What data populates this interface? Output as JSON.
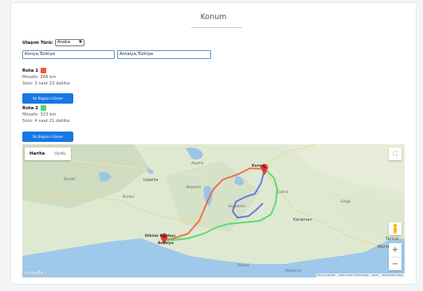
{
  "page": {
    "title": "Konum"
  },
  "form": {
    "transport_label": "Ulaşım Türü:",
    "transport_selected": "Araba",
    "origin_value": "Konya,Türkiye",
    "destination_value": "Antalya,Türkiye"
  },
  "routes": [
    {
      "title": "Rota 1",
      "color": "#f05a3a",
      "distance": "Mesafe: 266 km",
      "duration": "Süre: 3 saat 23 dakika",
      "button": "Yol Bilgisini Göster"
    },
    {
      "title": "Rota 2",
      "color": "#4cd964",
      "distance": "Mesafe: 323 km",
      "duration": "Süre: 4 saat 21 dakika",
      "button": "Yol Bilgisini Göster"
    }
  ],
  "map": {
    "type_active": "Harita",
    "type_inactive": "Uydu",
    "fullscreen_icon": "⛶",
    "zoom_in": "+",
    "zoom_out": "−",
    "google_logo": "Google",
    "attribution": {
      "shortcuts": "Klavye kısayolları",
      "data": "Harita verileri ©2024 Google",
      "terms": "Şartlar",
      "report": "Harita hatası bildirin"
    },
    "labels": {
      "origin": "Konya",
      "destination": "Antalya",
      "waypoint": "Etkisiz Noktası",
      "karaman": "Karaman",
      "mersin": "Mersin",
      "tarsus": "Tarsus",
      "alanya": "Alanya",
      "isparta": "Isparta",
      "denizli": "Denizli",
      "aksehir": "Akşehir",
      "beysehir": "Beyşehir",
      "seydisehir": "Seydişehir",
      "burdur": "Burdur",
      "cumra": "Çumra",
      "eregli": "Ereğli",
      "akdeniz": "Akdeniz"
    },
    "route_colors": {
      "route1": "#f05a3a",
      "route2": "#4cd964",
      "alt": "#5a6ee0"
    }
  }
}
